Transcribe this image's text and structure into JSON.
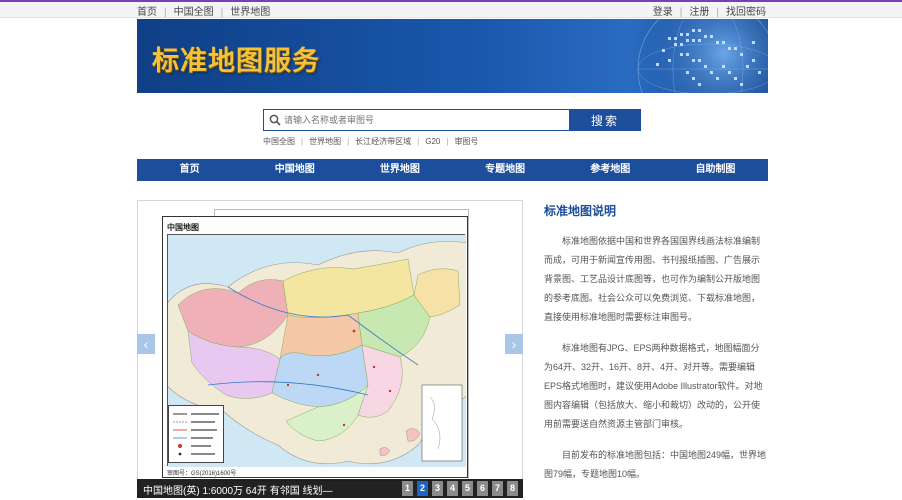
{
  "topbar": {
    "left_links": [
      "首页",
      "中国全图",
      "世界地图"
    ],
    "right_links": [
      "登录",
      "注册",
      "找回密码"
    ]
  },
  "banner": {
    "title": "标准地图服务"
  },
  "search": {
    "placeholder": "请输入名称或者审图号",
    "button_label": "搜索"
  },
  "quick_links": [
    "中国全图",
    "世界地图",
    "长江经济带区域",
    "G20",
    "审图号"
  ],
  "nav": [
    "首页",
    "中国地图",
    "世界地图",
    "专题地图",
    "参考地图",
    "自助制图"
  ],
  "slider": {
    "map_title": "中国地图",
    "review_no": "审图号：GS(2016)1600号",
    "caption": "中国地图(英) 1:6000万 64开 有邻国 线划—",
    "pages": [
      "1",
      "2",
      "3",
      "4",
      "5",
      "6",
      "7",
      "8"
    ],
    "active_page": "2"
  },
  "info": {
    "title": "标准地图说明",
    "paragraphs": [
      "标准地图依据中国和世界各国国界线画法标准编制而成，可用于新闻宣传用图、书刊报纸插图、广告展示背景图、工艺品设计底图等，也可作为编制公开版地图的参考底图。社会公众可以免费浏览、下载标准地图，直接使用标准地图时需要标注审图号。",
      "标准地图有JPG、EPS两种数据格式，地图幅面分为64开、32开、16开、8开、4开、对开等。需要编辑EPS格式地图时，建议使用Adobe Illustrator软件。对地图内容编辑（包括放大、缩小和裁切）改动的，公开使用前需要送自然资源主管部门审核。",
      "目前发布的标准地图包括：中国地图249幅，世界地图79幅，专题地图10幅。"
    ]
  },
  "colors": {
    "primary": "#1c4e9c",
    "banner_title": "#f3c23a",
    "active_page": "#1c64c8"
  }
}
